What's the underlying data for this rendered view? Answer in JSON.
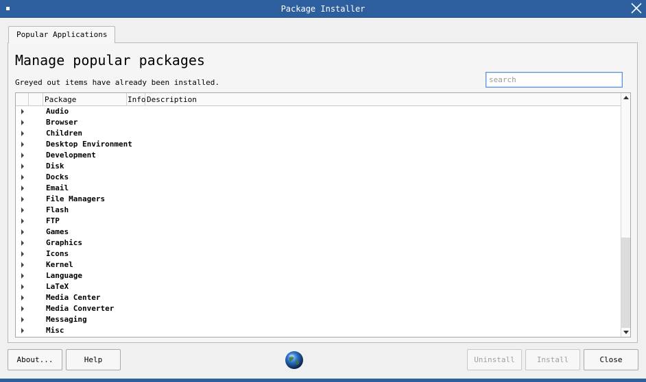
{
  "window": {
    "title": "Package Installer"
  },
  "tabs": [
    {
      "label": "Popular Applications"
    }
  ],
  "main": {
    "heading": "Manage popular packages",
    "subtext": "Greyed out items have already been installed.",
    "search_placeholder": "search"
  },
  "tree": {
    "columns": [
      "",
      "",
      "Package",
      "Info",
      "Description"
    ],
    "items": [
      "Audio",
      "Browser",
      "Children",
      "Desktop Environment",
      "Development",
      "Disk",
      "Docks",
      "Email",
      "File Managers",
      "Flash",
      "FTP",
      "Games",
      "Graphics",
      "Icons",
      "Kernel",
      "Language",
      "LaTeX",
      "Media Center",
      "Media Converter",
      "Messaging",
      "Misc"
    ]
  },
  "buttons": {
    "about": "About...",
    "help": "Help",
    "uninstall": "Uninstall",
    "install": "Install",
    "close": "Close"
  },
  "colors": {
    "titlebar": "#2d5f9e",
    "search_focus": "#5b8fd6"
  },
  "icons": {
    "window_menu": "window-menu-icon",
    "window_close": "close-icon",
    "expand": "expand-arrow-icon",
    "logo": "globe-icon"
  }
}
